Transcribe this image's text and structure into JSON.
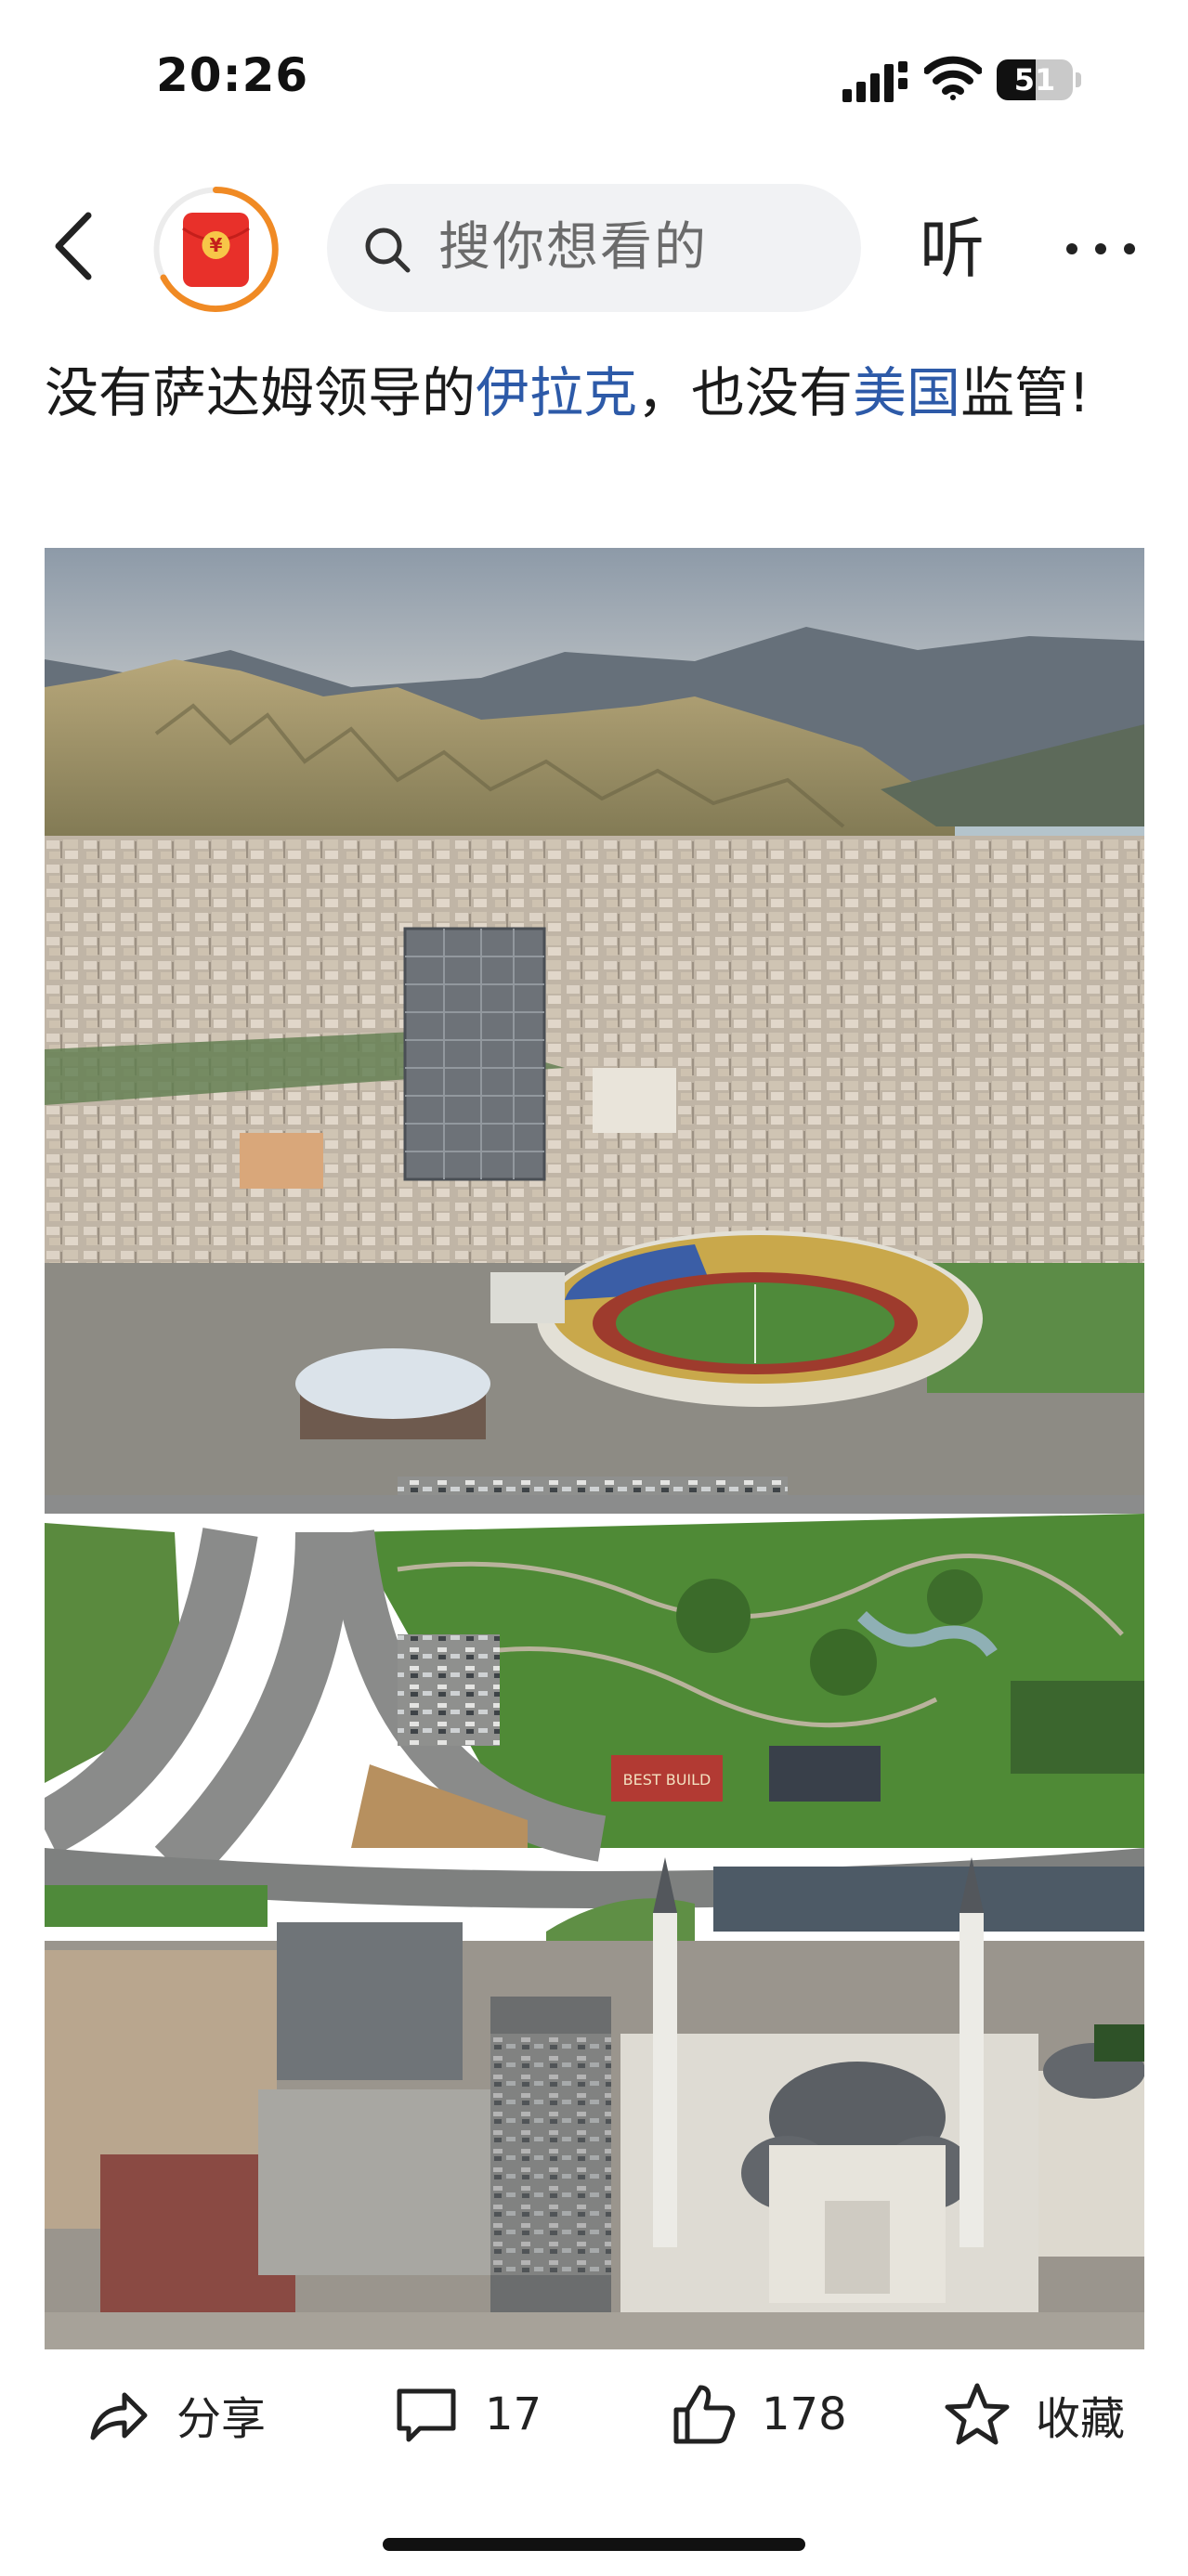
{
  "status_bar": {
    "time": "20:26",
    "battery": "51",
    "battery_level_percent": 51
  },
  "nav": {
    "search_placeholder": "搜你想看的",
    "listen_label": "听",
    "icons": [
      "back-arrow-icon",
      "red-packet-icon",
      "search-icon",
      "more-icon"
    ]
  },
  "post": {
    "title_part1": "没有萨达姆领导的",
    "title_link1": "伊拉克",
    "title_part2": "，也没有",
    "title_link2": "美国",
    "title_part3": "监管!",
    "image_sign_text": "BEST BUILD"
  },
  "actions": {
    "share_label": "分享",
    "comment_count": "17",
    "like_count": "178",
    "favorite_label": "收藏"
  },
  "colors": {
    "link": "#2d5aa8",
    "accent_orange": "#f08a24",
    "red_packet": "#e8302a"
  }
}
